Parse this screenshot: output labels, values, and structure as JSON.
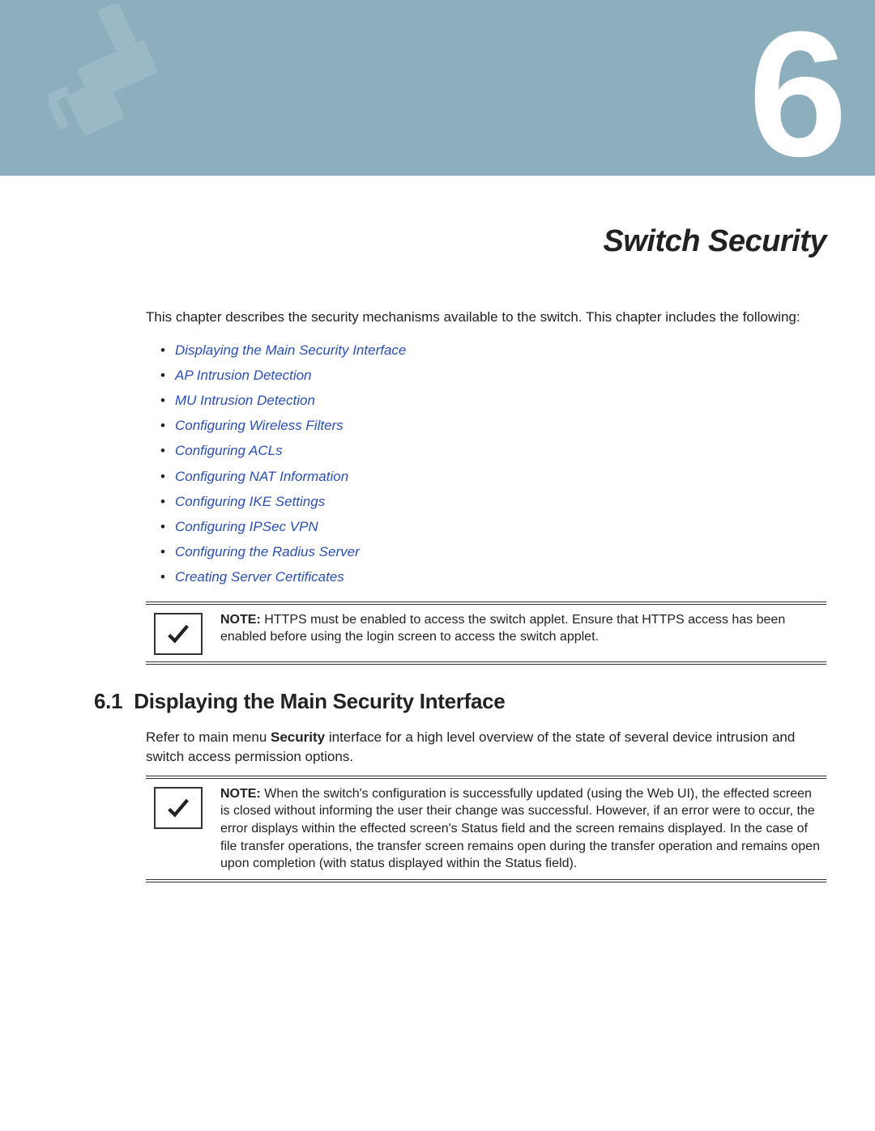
{
  "banner": {
    "chapter_number": "6"
  },
  "chapter_title": "Switch Security",
  "intro": "This chapter describes the security mechanisms available to the switch. This chapter includes the following:",
  "toc": [
    "Displaying the Main Security Interface",
    "AP Intrusion Detection",
    "MU Intrusion Detection",
    "Configuring Wireless Filters",
    "Configuring ACLs",
    "Configuring NAT Information",
    "Configuring IKE Settings",
    "Configuring IPSec VPN",
    "Configuring the Radius Server",
    "Creating Server Certificates"
  ],
  "note1": {
    "label": "NOTE:",
    "text": " HTTPS must be enabled to access the switch applet. Ensure that HTTPS access has been enabled before using the login screen to access the switch applet."
  },
  "section1": {
    "number": "6.1",
    "title": "Displaying the Main Security Interface",
    "body_pre": "Refer to main menu ",
    "body_bold": "Security",
    "body_post": " interface for a high level overview of the state of several device intrusion and switch access permission options."
  },
  "note2": {
    "label": "NOTE:",
    "text": " When the switch's configuration is successfully updated (using the Web UI), the effected screen is closed without informing the user their change was successful. However, if an error were to occur, the error displays within the effected screen's Status field and the screen remains displayed. In the case of file transfer operations, the transfer screen remains open during the transfer operation and remains open upon completion (with status displayed within the Status field)."
  }
}
